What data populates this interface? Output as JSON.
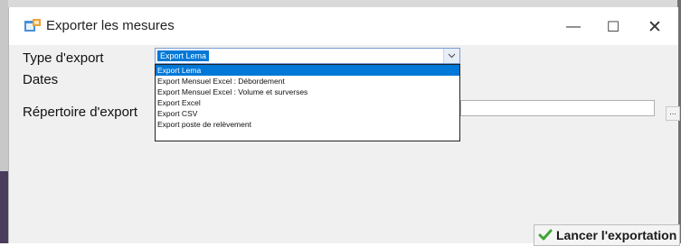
{
  "window": {
    "title": "Exporter les mesures",
    "controls": {
      "minimize": "—",
      "maximize": "☐",
      "close": "✕"
    }
  },
  "form": {
    "type_label": "Type d'export",
    "dates_label": "Dates",
    "directory_label": "Répertoire d'export",
    "directory_value": "",
    "browse_label": "...",
    "export_type": {
      "selected": "Export Lema",
      "options": [
        "Export Lema",
        "Export Mensuel Excel : Débordement",
        "Export Mensuel Excel : Volume et surverses",
        "Export Excel",
        "Export CSV",
        "Export poste de relèvement"
      ],
      "highlighted_index": 0
    }
  },
  "actions": {
    "export_label": "Lancer l'exportation"
  },
  "colors": {
    "selection": "#0078d7",
    "check": "#3fa535"
  },
  "icons": {
    "title": "app-window-icon",
    "dropdown": "chevron-down-icon",
    "export": "checkmark-icon"
  }
}
